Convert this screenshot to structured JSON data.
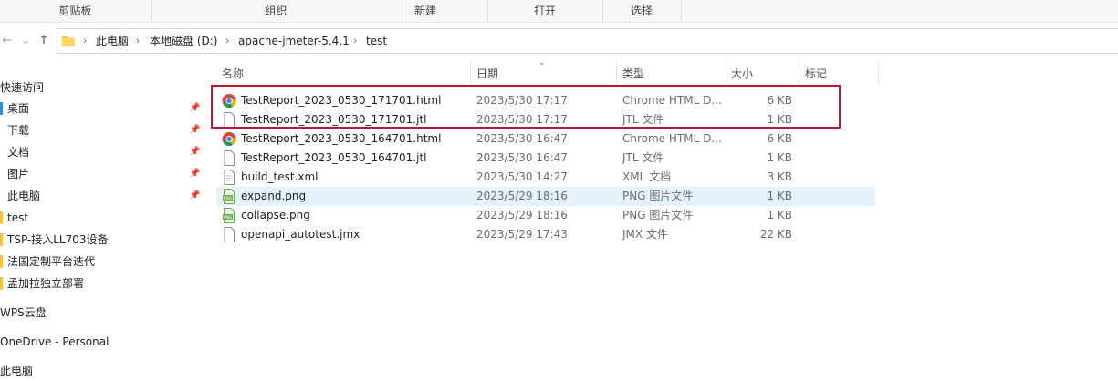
{
  "ribbon": {
    "groups": [
      "剪贴板",
      "组织",
      "新建",
      "打开",
      "选择"
    ]
  },
  "nav": {
    "back_icon": "arrow-left-icon",
    "forward_icon": "arrow-right-icon",
    "up_icon": "arrow-up-icon"
  },
  "address": {
    "crumbs": [
      "此电脑",
      "本地磁盘 (D:)",
      "apache-jmeter-5.4.1",
      "test"
    ]
  },
  "sidebar": {
    "quick_access": "快速访问",
    "items": [
      {
        "label": "桌面",
        "pinned": true
      },
      {
        "label": "下载",
        "pinned": true
      },
      {
        "label": "文档",
        "pinned": true
      },
      {
        "label": "图片",
        "pinned": true
      },
      {
        "label": "此电脑",
        "pinned": true
      },
      {
        "label": "test",
        "pinned": false
      },
      {
        "label": "TSP-接入LL703设备",
        "pinned": false
      },
      {
        "label": "法国定制平台迭代",
        "pinned": false
      },
      {
        "label": "孟加拉独立部署",
        "pinned": false
      }
    ],
    "wps": "WPS云盘",
    "onedrive": "OneDrive - Personal",
    "this_pc": "此电脑"
  },
  "columns": {
    "name": "名称",
    "date": "日期",
    "type": "类型",
    "size": "大小",
    "tags": "标记"
  },
  "files": [
    {
      "name": "TestReport_2023_0530_171701.html",
      "date": "2023/5/30 17:17",
      "type": "Chrome HTML D...",
      "size": "6 KB",
      "icon": "chrome-icon"
    },
    {
      "name": "TestReport_2023_0530_171701.jtl",
      "date": "2023/5/30 17:17",
      "type": "JTL 文件",
      "size": "1 KB",
      "icon": "file-icon"
    },
    {
      "name": "TestReport_2023_0530_164701.html",
      "date": "2023/5/30 16:47",
      "type": "Chrome HTML D...",
      "size": "6 KB",
      "icon": "chrome-icon"
    },
    {
      "name": "TestReport_2023_0530_164701.jtl",
      "date": "2023/5/30 16:47",
      "type": "JTL 文件",
      "size": "1 KB",
      "icon": "file-icon"
    },
    {
      "name": "build_test.xml",
      "date": "2023/5/30 14:27",
      "type": "XML 文档",
      "size": "3 KB",
      "icon": "file-icon"
    },
    {
      "name": "expand.png",
      "date": "2023/5/29 18:16",
      "type": "PNG 图片文件",
      "size": "1 KB",
      "icon": "png-icon"
    },
    {
      "name": "collapse.png",
      "date": "2023/5/29 18:16",
      "type": "PNG 图片文件",
      "size": "1 KB",
      "icon": "png-icon"
    },
    {
      "name": "openapi_autotest.jmx",
      "date": "2023/5/29 17:43",
      "type": "JMX 文件",
      "size": "22 KB",
      "icon": "file-icon"
    }
  ],
  "colors": {
    "highlight_border": "#c4162a",
    "selected_row": "#e5f1fb",
    "folder": "#f5c542"
  }
}
